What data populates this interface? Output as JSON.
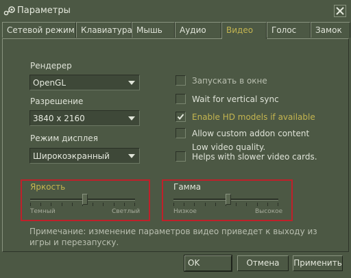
{
  "window": {
    "title": "Параметры"
  },
  "tabs": [
    {
      "label": "Сетевой режим"
    },
    {
      "label": "Клавиатура"
    },
    {
      "label": "Мышь"
    },
    {
      "label": "Аудио"
    },
    {
      "label": "Видео",
      "active": true
    },
    {
      "label": "Голос"
    },
    {
      "label": "Замок"
    }
  ],
  "renderer": {
    "label": "Рендерер",
    "value": "OpenGL"
  },
  "resolution": {
    "label": "Разрешение",
    "value": "3840 x 2160"
  },
  "display_mode": {
    "label": "Режим дисплея",
    "value": "Широкоэкранный"
  },
  "options": [
    {
      "label": "Запускать в окне",
      "checked": false
    },
    {
      "label": "Wait for vertical sync",
      "checked": false
    },
    {
      "label": "Enable HD models if available",
      "checked": true
    },
    {
      "label": "Allow custom addon content",
      "checked": false
    },
    {
      "label_line1": "Low video quality.",
      "label_line2": "Helps with slower video cards.",
      "checked": false
    }
  ],
  "brightness": {
    "label": "Яркость",
    "min_label": "Темный",
    "max_label": "Светлый",
    "level_fraction": 0.52
  },
  "gamma": {
    "label": "Гамма",
    "min_label": "Низкое",
    "max_label": "Высокое",
    "level_fraction": 0.52
  },
  "note": "Примечание: изменение параметров видео приведет к выходу из игры и перезапуску.",
  "buttons": {
    "ok": "OK",
    "cancel": "Отмена",
    "apply": "Применить"
  },
  "colors": {
    "background": "#4c5844",
    "highlight_text": "#c4b550",
    "annotation_box": "#c0202a"
  },
  "icons": {
    "app": "steam-icon",
    "close": "close-icon",
    "dropdown": "chevron-down-icon",
    "check": "checkmark-icon"
  }
}
